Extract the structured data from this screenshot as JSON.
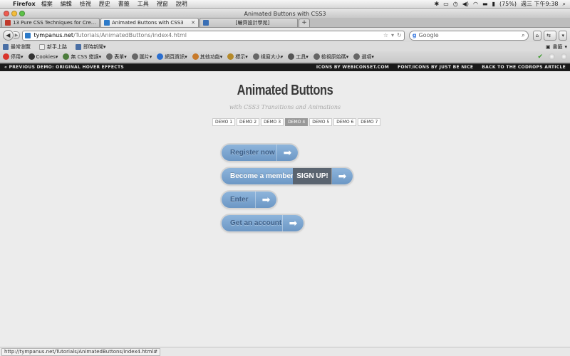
{
  "menubar": {
    "app": "Firefox",
    "items": [
      "檔案",
      "編輯",
      "檢視",
      "歷史",
      "書籤",
      "工具",
      "視窗",
      "說明"
    ],
    "battery": "(75%)",
    "clock": "週三 下午9:38"
  },
  "window": {
    "title": "Animated Buttons with CSS3"
  },
  "tabs": [
    {
      "label": "13 Pure CSS Techniques for Cre...",
      "fav": "#c0392b",
      "active": false
    },
    {
      "label": "Animated Buttons with CSS3",
      "fav": "#2c7ac9",
      "active": true
    },
    {
      "label": "[輪齊設計學苑]",
      "fav": "#3a6fb5",
      "active": false
    }
  ],
  "nav": {
    "url_domain": "tympanus.net",
    "url_path": "/Tutorials/AnimatedButtons/index4.html",
    "search_placeholder": "Google"
  },
  "bookmarks": [
    {
      "label": "最常瀏覽",
      "color": "#4a6fa5"
    },
    {
      "label": "新手上路",
      "color": "#f0f0f0"
    },
    {
      "label": "即時新聞",
      "color": "#4a6fa5"
    }
  ],
  "bookmarks_right": "書籤",
  "addons": [
    {
      "label": "停用",
      "color": "#d9342b"
    },
    {
      "label": "Cookies",
      "color": "#333333"
    },
    {
      "label": "無 CSS 錯誤",
      "color": "#4c7c3c"
    },
    {
      "label": "表單",
      "color": "#666666"
    },
    {
      "label": "圖片",
      "color": "#666666"
    },
    {
      "label": "網頁資訊",
      "color": "#2a6ecf"
    },
    {
      "label": "其他功能",
      "color": "#c87a2a"
    },
    {
      "label": "標示",
      "color": "#b58a2a"
    },
    {
      "label": "視窗大小",
      "color": "#666666"
    },
    {
      "label": "工具",
      "color": "#555555"
    },
    {
      "label": "檢視原始碼",
      "color": "#666666"
    },
    {
      "label": "選項",
      "color": "#666666"
    }
  ],
  "codrops": {
    "prev": "« PREVIOUS DEMO: ORIGINAL HOVER EFFECTS",
    "icons": "ICONS BY WEBICONSET.COM",
    "fonts": "FONT/ICONS BY JUST BE NICE",
    "back": "BACK TO THE CODROPS ARTICLE"
  },
  "page": {
    "title": "Animated Buttons",
    "subtitle": "with CSS3 Transitions and Animations",
    "demos": [
      "DEMO 1",
      "DEMO 2",
      "DEMO 3",
      "DEMO 4",
      "DEMO 5",
      "DEMO 6",
      "DEMO 7"
    ],
    "active_demo": "DEMO 4",
    "buttons": {
      "register": "Register now",
      "member": "Become a member",
      "signup": "SIGN UP!",
      "enter": "Enter",
      "account": "Get an account"
    },
    "arrow_glyph": "➡"
  },
  "status": "http://tympanus.net/Tutorials/AnimatedButtons/index4.html#"
}
